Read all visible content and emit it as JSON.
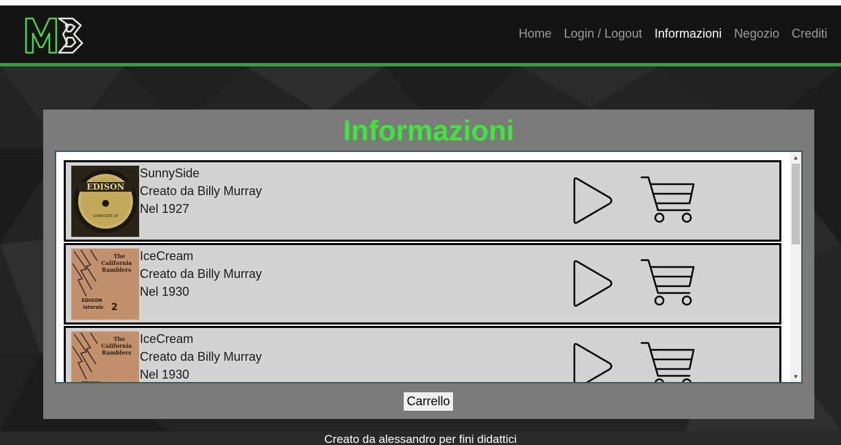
{
  "nav": {
    "links": [
      {
        "label": "Home",
        "active": false
      },
      {
        "label": "Login / Logout",
        "active": false
      },
      {
        "label": "Informazioni",
        "active": true
      },
      {
        "label": "Negozio",
        "active": false
      },
      {
        "label": "Crediti",
        "active": false
      }
    ]
  },
  "colors": {
    "accent_green": "#3ee63a",
    "nav_line": "#3f9b48",
    "logo_green": "#4cd44a"
  },
  "panel": {
    "title": "Informazioni",
    "cart_button": "Carrello"
  },
  "songs": [
    {
      "title": "SunnySide",
      "author": "Creato da Billy Murray",
      "year": "Nel 1927",
      "cover_label": "EDISON",
      "cover_sub": "SUNNYSIDE UP"
    },
    {
      "title": "IceCream",
      "author": "Creato da Billy Murray",
      "year": "Nel 1930",
      "cover_label": "The California Ramblers",
      "cover_sub": "EDISON laterals 2"
    },
    {
      "title": "IceCream",
      "author": "Creato da Billy Murray",
      "year": "Nel 1930",
      "cover_label": "The California Ramblers",
      "cover_sub": "EDISON"
    }
  ],
  "footer": {
    "text": "Creato da alessandro per fini didattici"
  }
}
